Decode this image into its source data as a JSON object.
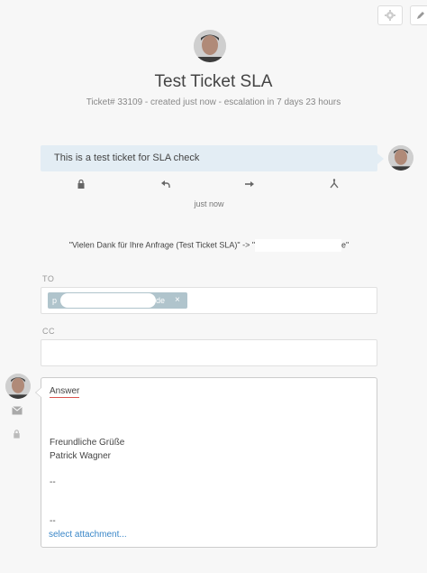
{
  "toolbar": {
    "settings_icon": "gear-icon",
    "edit_icon": "pencil-icon"
  },
  "ticket": {
    "title": "Test Ticket SLA",
    "meta": "Ticket# 33109 - created just now - escalation in 7 days 23 hours"
  },
  "article": {
    "body": "This is a test ticket for SLA check",
    "time": "just now",
    "actions": [
      "lock-icon",
      "reply-icon",
      "forward-icon",
      "split-icon"
    ]
  },
  "subject": {
    "prefix": "\"Vielen Dank für Ihre Anfrage (Test Ticket SLA)\" -> \"",
    "suffix": "e\""
  },
  "reply": {
    "to_label": "TO",
    "to_token_prefix": "p",
    "to_token_suffix": "de",
    "to_token_remove": "×",
    "cc_label": "CC",
    "lines": {
      "answer": "Answer",
      "greeting": "Freundliche Grüße",
      "name": "Patrick Wagner",
      "sep1": "--",
      "sep2": "--"
    },
    "attach": "select attachment..."
  },
  "colors": {
    "bubble": "#e3edf4",
    "token": "#b0c4cc",
    "link": "#3a87c8"
  }
}
